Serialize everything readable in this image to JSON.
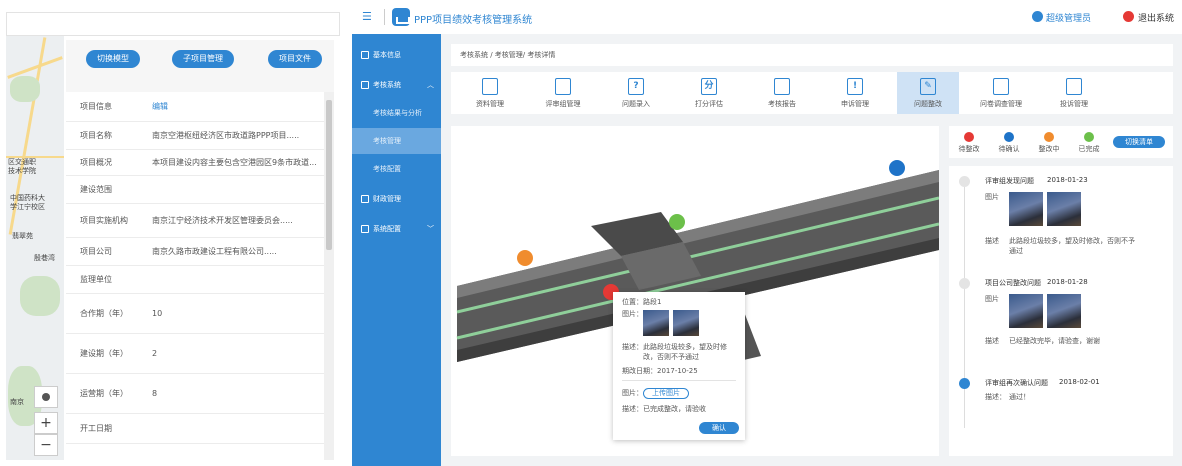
{
  "left": {
    "buttons": [
      "切换模型",
      "子项目管理",
      "项目文件"
    ],
    "header_key": "项目信息",
    "edit_label": "编辑",
    "rows": [
      {
        "k": "项目名称",
        "v": "南京空港枢纽经济区市政道路PPP项目....."
      },
      {
        "k": "项目概况",
        "v": "本项目建设内容主要包含空港园区9条市政道..."
      },
      {
        "k": "建设范围",
        "v": ""
      },
      {
        "k": "项目实施机构",
        "v": "南京江宁经济技术开发区管理委员会....."
      },
      {
        "k": "项目公司",
        "v": "南京久路市政建设工程有限公司....."
      },
      {
        "k": "监理单位",
        "v": ""
      },
      {
        "k": "合作期（年）",
        "v": "10"
      },
      {
        "k": "建设期（年）",
        "v": "2"
      },
      {
        "k": "运营期（年）",
        "v": "8"
      },
      {
        "k": "开工日期",
        "v": ""
      }
    ],
    "map_labels": [
      "区交通职",
      "技术学院",
      "中国药科大",
      "学江宁校区",
      "南京",
      "翡翠苑",
      "殷巷湾"
    ],
    "zoom_in": "+",
    "zoom_out": "−"
  },
  "header": {
    "title": "PPP项目绩效考核管理系统",
    "user": "超级管理员",
    "exit": "退出系统"
  },
  "sidebar": [
    {
      "label": "基本信息",
      "type": "main"
    },
    {
      "label": "考核系统",
      "type": "main",
      "chev": "^"
    },
    {
      "label": "考核结果与分析",
      "type": "sub"
    },
    {
      "label": "考核管理",
      "type": "sub",
      "active": true
    },
    {
      "label": "考核配置",
      "type": "sub"
    },
    {
      "label": "财政管理",
      "type": "main"
    },
    {
      "label": "系统配置",
      "type": "main",
      "chev": "v"
    }
  ],
  "breadcrumb": "考核系统  /  考核管理/  考核详情",
  "toolbar": [
    {
      "label": "资料管理",
      "icon": "folder-icon",
      "glyph": ""
    },
    {
      "label": "评审组管理",
      "icon": "user-edit-icon",
      "glyph": ""
    },
    {
      "label": "问题录入",
      "icon": "question-edit-icon",
      "glyph": "?"
    },
    {
      "label": "打分评估",
      "icon": "score-icon",
      "glyph": "分"
    },
    {
      "label": "考核报告",
      "icon": "report-icon",
      "glyph": ""
    },
    {
      "label": "申诉管理",
      "icon": "alert-icon",
      "glyph": "!"
    },
    {
      "label": "问题整改",
      "icon": "rectify-icon",
      "glyph": "✎",
      "active": true
    },
    {
      "label": "问卷调查管理",
      "icon": "survey-icon",
      "glyph": ""
    },
    {
      "label": "投诉管理",
      "icon": "complaint-icon",
      "glyph": ""
    }
  ],
  "legend": [
    {
      "label": "待整改",
      "color": "#e53935"
    },
    {
      "label": "待确认",
      "color": "#1e73c8"
    },
    {
      "label": "整改中",
      "color": "#f08c2e"
    },
    {
      "label": "已完成",
      "color": "#6cc04a"
    }
  ],
  "switch_label": "切换清单",
  "popup": {
    "pos_label": "位置：",
    "pos_value": "路段1",
    "pic_label": "图片：",
    "desc_label": "描述：",
    "desc_value": "此路段垃圾较多，望及时修改，否则不予通过",
    "date_label": "期改日期：",
    "date_value": "2017-10-25",
    "pic2_label": "图片：",
    "upload": "上传图片",
    "desc2_label": "描述：",
    "desc2_value": "已完成整改，请验收",
    "confirm": "确认"
  },
  "timeline": [
    {
      "title": "评审组发现问题",
      "date": "2018-01-23",
      "pic_label": "图片",
      "desc_label": "描述",
      "desc": "此路段垃圾较多，望及时修改，否则不予通过",
      "photos": 2
    },
    {
      "title": "项目公司整改问题",
      "date": "2018-01-28",
      "pic_label": "图片",
      "desc_label": "描述",
      "desc": "已经整改完毕，请验查，谢谢",
      "photos": 2
    },
    {
      "title": "评审组再次确认问题",
      "date": "2018-02-01",
      "desc_label": "描述：",
      "desc": "通过！",
      "photos": 0
    }
  ]
}
